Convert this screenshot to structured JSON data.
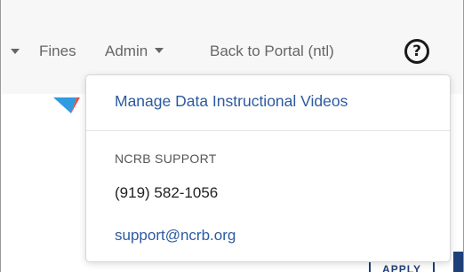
{
  "nav": {
    "fines_label": "Fines",
    "admin_label": "Admin",
    "back_label": "Back to Portal (ntl)",
    "help_icon_glyph": "?",
    "caret_icon": "caret-down-icon",
    "help_icon": "question-circle-icon"
  },
  "dropdown": {
    "menu_items": [
      "Manage Data Instructional Videos"
    ],
    "support": {
      "header": "NCRB SUPPORT",
      "phone": "(919) 582-1056",
      "email": "support@ncrb.org"
    }
  },
  "background": {
    "apply_label": "APPLY"
  },
  "colors": {
    "link_blue": "#2c5aa0",
    "navy": "#1f3f7a",
    "nav_text": "#666666",
    "navbar_bg": "#f7f7f7"
  }
}
